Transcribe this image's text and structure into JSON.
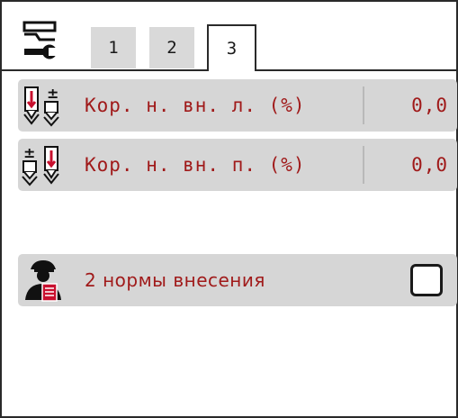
{
  "header": {
    "icon": "settings-wrench-icon",
    "tabs": [
      {
        "label": "1",
        "active": false
      },
      {
        "label": "2",
        "active": false
      },
      {
        "label": "3",
        "active": true
      }
    ]
  },
  "rows": [
    {
      "icon": "correction-left-icon",
      "label": "Кор. н. вн. л. (%)",
      "value": "0,0"
    },
    {
      "icon": "correction-right-icon",
      "label": "Кор. н. вн. п. (%)",
      "value": "0,0"
    },
    {
      "icon": "operator-document-icon",
      "label": "2 нормы внесения",
      "checked": false
    }
  ],
  "colors": {
    "accent_text": "#a01a1a",
    "row_background": "#d6d6d6",
    "tab_inactive": "#d9d9d9",
    "icon_red": "#c8102e"
  }
}
